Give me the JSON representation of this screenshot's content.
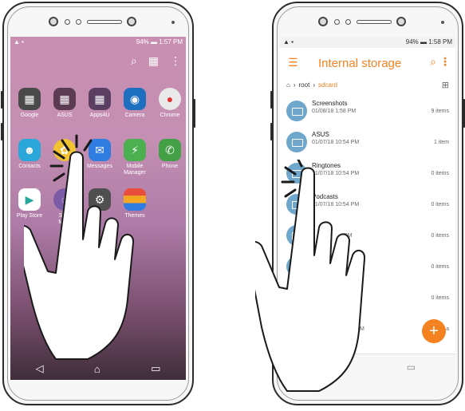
{
  "phone1": {
    "status": {
      "left": "▲ ▪",
      "right": "94% ▬ 1:57 PM"
    },
    "header_icons": [
      "search-icon",
      "widgets-icon",
      "more-icon"
    ],
    "apps_row1": [
      {
        "label": "Google",
        "color": "#4a4a4a"
      },
      {
        "label": "ASUS",
        "color": "#5b3b52"
      },
      {
        "label": "Apps4U",
        "color": "#5a3f63"
      },
      {
        "label": "Camera",
        "color": "#1f6fc1"
      },
      {
        "label": "Chrome",
        "color": "#e9e9e9"
      }
    ],
    "apps_row2": [
      {
        "label": "Contacts",
        "color": "#2aa7d8"
      },
      {
        "label": "",
        "color": "#f1c232"
      },
      {
        "label": "Messages",
        "color": "#2f7de1"
      },
      {
        "label": "Mobile\nManager",
        "color": "#4caf50"
      },
      {
        "label": "Phone",
        "color": "#43a047"
      }
    ],
    "apps_row3": [
      {
        "label": "Play Store",
        "color": "#ffffff"
      },
      {
        "label": "Se...\nMa...",
        "color": "#7b5aa6"
      },
      {
        "label": "",
        "color": "#4f4f4f"
      },
      {
        "label": "Themes",
        "color": "#e94e3d"
      }
    ]
  },
  "phone2": {
    "status": {
      "left": "▲ ▪",
      "right": "94% ▬ 1:58 PM"
    },
    "title": "Internal storage",
    "breadcrumb": {
      "root": "root",
      "current": "sdcard"
    },
    "rows": [
      {
        "name": "Screenshots",
        "date": "01/08/18 1:58 PM",
        "count": "9 items"
      },
      {
        "name": "ASUS",
        "date": "01/07/18 10:54 PM",
        "count": "1 item"
      },
      {
        "name": "Ringtones",
        "date": "01/07/18 10:54 PM",
        "count": "0 items"
      },
      {
        "name": "Podcasts",
        "date": "01/07/18 10:54 PM",
        "count": "0 items"
      },
      {
        "name": "",
        "date": "PM",
        "count": "0 items"
      },
      {
        "name": "",
        "date": "",
        "count": "0 items"
      },
      {
        "name": "",
        "date": "",
        "count": "0 items"
      },
      {
        "name": "",
        "date": "M",
        "count": "a"
      }
    ],
    "fab": "+"
  },
  "colors": {
    "accent": "#f58220",
    "folder": "#6ea6cc"
  }
}
